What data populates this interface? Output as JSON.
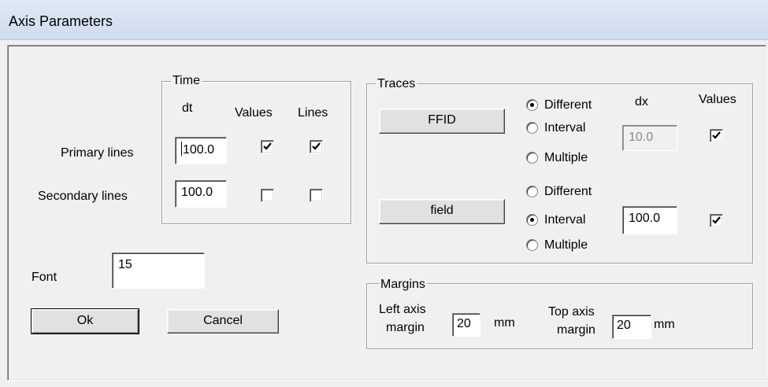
{
  "window": {
    "title": "Axis Parameters"
  },
  "time": {
    "group_label": "Time",
    "col_dt": "dt",
    "col_values": "Values",
    "col_lines": "Lines",
    "primary": {
      "label": "Primary lines",
      "dt": "100.0",
      "values_checked": true,
      "lines_checked": true
    },
    "secondary": {
      "label": "Secondary lines",
      "dt": "100.0",
      "values_checked": false,
      "lines_checked": false
    }
  },
  "traces": {
    "group_label": "Traces",
    "col_dx": "dx",
    "col_values": "Values",
    "ffid": {
      "button_label": "FFID",
      "options": [
        "Different",
        "Interval",
        "Multiple"
      ],
      "selected": "Different",
      "dx": "10.0",
      "dx_enabled": false,
      "values_checked": true
    },
    "field": {
      "button_label": "field",
      "options": [
        "Different",
        "Interval",
        "Multiple"
      ],
      "selected": "Interval",
      "dx": "100.0",
      "dx_enabled": true,
      "values_checked": true
    }
  },
  "font": {
    "label": "Font",
    "value": "15"
  },
  "buttons": {
    "ok": "Ok",
    "cancel": "Cancel"
  },
  "margins": {
    "group_label": "Margins",
    "left_label_1": "Left axis",
    "left_label_2": "margin",
    "left_value": "20",
    "left_unit": "mm",
    "top_label_1": "Top axis",
    "top_label_2": "margin",
    "top_value": "20",
    "top_unit": "mm"
  }
}
